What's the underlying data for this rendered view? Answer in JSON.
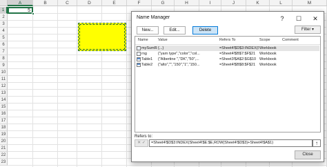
{
  "sheet": {
    "columns": [
      "A",
      "B",
      "C",
      "D",
      "E",
      "F",
      "G",
      "H",
      "I",
      "J",
      "K",
      "L",
      "M"
    ],
    "rows": [
      "1",
      "2",
      "3",
      "4",
      "5",
      "6",
      "7",
      "8",
      "9",
      "10",
      "11",
      "12",
      "13",
      "14",
      "15",
      "16",
      "17",
      "18",
      "19",
      "20",
      "21",
      "22",
      "23"
    ],
    "active_cell_value": "5",
    "fill_color": "#ffff00",
    "selection_color": "#217346"
  },
  "dialog": {
    "title": "Name Manager",
    "buttons": {
      "new": "New...",
      "edit": "Edit...",
      "delete": "Delete",
      "filter": "Filter",
      "close": "Close"
    },
    "columns": [
      "Name",
      "Value",
      "Refers To",
      "Scope",
      "Comment"
    ],
    "names": [
      {
        "icon": "name-icon",
        "name": "mySumRange",
        "value": "{...}",
        "refers_to": "=Sheet4!$D$3:INDEX($...",
        "scope": "Workbook",
        "comment": ""
      },
      {
        "icon": "name-icon",
        "name": "rng",
        "value": "{\"yarn type\",\"color\",\"col...",
        "refers_to": "=Sheet4!$B$7:$F$21",
        "scope": "Workbook",
        "comment": ""
      },
      {
        "icon": "table-icon",
        "name": "Table1",
        "value": "{\"Albertine \",\"DK\",\"50\",...",
        "refers_to": "=Sheet3!$A$2:$G$10",
        "scope": "Workbook",
        "comment": ""
      },
      {
        "icon": "table-icon",
        "name": "Table2",
        "value": "{\"alto\",\"\",\"150\",\"1\",\"150...",
        "refers_to": "=Sheet4!$B$8:$F$21",
        "scope": "Workbook",
        "comment": ""
      }
    ],
    "refers_to_label": "Refers to:",
    "refers_to_value": "=Sheet4!$D$3:INDEX(Sheet4!$E:$E,ROW(Sheet4!$D$3)+Sheet4!$A$1)"
  }
}
